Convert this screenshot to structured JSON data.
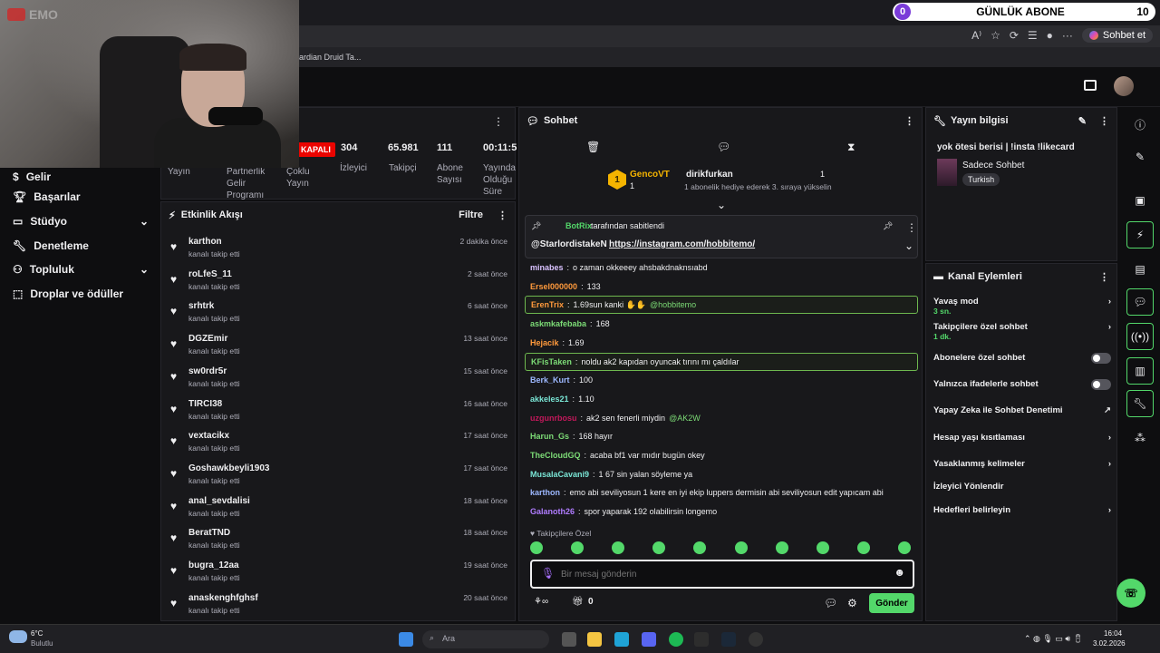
{
  "browser": {
    "sub_counter": {
      "current": "0",
      "title": "GÜNLÜK ABONE",
      "goal": "10"
    },
    "bookmark_text": "ardian Druid Ta...",
    "chat_button_label": "Sohbet et"
  },
  "webcam": {
    "logo_text": "EMO"
  },
  "left_nav": {
    "items": [
      {
        "label": "Gelir",
        "icon": "dollar-icon"
      },
      {
        "label": "Başarılar",
        "icon": "trophy-icon"
      },
      {
        "label": "Stüdyo",
        "icon": "studio-icon"
      },
      {
        "label": "Denetleme",
        "icon": "wrench-icon"
      },
      {
        "label": "Topluluk",
        "icon": "community-icon"
      },
      {
        "label": "Droplar ve ödüller",
        "icon": "drops-icon"
      }
    ]
  },
  "stats": {
    "offline_badge": "KAPALI",
    "items": [
      {
        "value": "304",
        "label": "İzleyici"
      },
      {
        "value": "65.981",
        "label": "Takipçi"
      },
      {
        "value": "111",
        "label": "Abone Sayısı"
      },
      {
        "value": "00:11:5",
        "label": "Yayında Olduğu Süre"
      }
    ],
    "left_labels": [
      "Yayın",
      "Partnerlik Gelir Programı",
      "Çoklu Yayın"
    ]
  },
  "feed": {
    "title": "Etkinlik Akışı",
    "filter_label": "Filtre",
    "rows": [
      {
        "user": "karthon",
        "action": "kanalı takip etti",
        "time": "2 dakika önce"
      },
      {
        "user": "roLfeS_11",
        "action": "kanalı takip etti",
        "time": "2 saat önce"
      },
      {
        "user": "srhtrk",
        "action": "kanalı takip etti",
        "time": "6 saat önce"
      },
      {
        "user": "DGZEmir",
        "action": "kanalı takip etti",
        "time": "13 saat önce"
      },
      {
        "user": "sw0rdr5r",
        "action": "kanalı takip etti",
        "time": "15 saat önce"
      },
      {
        "user": "TIRCI38",
        "action": "kanalı takip etti",
        "time": "16 saat önce"
      },
      {
        "user": "vextacikx",
        "action": "kanalı takip etti",
        "time": "17 saat önce"
      },
      {
        "user": "Goshawkbeyli1903",
        "action": "kanalı takip etti",
        "time": "17 saat önce"
      },
      {
        "user": "anal_sevdalisi",
        "action": "kanalı takip etti",
        "time": "18 saat önce"
      },
      {
        "user": "BeratTND",
        "action": "kanalı takip etti",
        "time": "18 saat önce"
      },
      {
        "user": "bugra_12aa",
        "action": "kanalı takip etti",
        "time": "19 saat önce"
      },
      {
        "user": "anaskenghfghsf",
        "action": "kanalı takip etti",
        "time": "20 saat önce"
      }
    ]
  },
  "chat": {
    "title": "Sohbet",
    "gift": {
      "rank": "1",
      "gifter": "GencoVT",
      "gifter_count": "1",
      "recipient": "dirikfurkan",
      "recipient_count": "1",
      "message": "1 abonelik hediye ederek 3. sıraya yükselin"
    },
    "pinned": {
      "by_user": "BotRix",
      "by_text": "tarafından sabitlendi",
      "mention": "@StarlordistakeN",
      "link": "https://instagram.com/hobbitemo/"
    },
    "messages": [
      {
        "user": "minabes",
        "color": "#d9c2ff",
        "text": "o zaman okkeeey ahsbakdnaknsıabd",
        "highlight": false
      },
      {
        "user": "Ersel000000",
        "color": "#ff9a3c",
        "text": "133",
        "highlight": false
      },
      {
        "user": "ErenTrix",
        "color": "#ff9a3c",
        "text": "1.69sun kanki ✋✋",
        "mention": "@hobbitemo",
        "highlight": true
      },
      {
        "user": "askmkafebaba",
        "color": "#7cdb76",
        "text": "168",
        "highlight": false
      },
      {
        "user": "Hejacik",
        "color": "#ff9a3c",
        "text": "1.69",
        "highlight": false
      },
      {
        "user": "KFisTaken",
        "color": "#7cdb76",
        "text": "noldu ak2 kapıdan oyuncak tırını mı çaldılar",
        "highlight": true
      },
      {
        "user": "Berk_Kurt",
        "color": "#9db8ff",
        "text": "100",
        "highlight": false
      },
      {
        "user": "akkeles21",
        "color": "#7ae6d6",
        "text": "1.10",
        "highlight": false
      },
      {
        "user": "uzgunrbosu",
        "color": "#c2185b",
        "text": "ak2 sen fenerli miydin",
        "mention": "@AK2W",
        "highlight": false
      },
      {
        "user": "Harun_Gs",
        "color": "#7cdb76",
        "text": "168 hayır",
        "highlight": false
      },
      {
        "user": "TheCloudGQ",
        "color": "#7cdb76",
        "text": "acaba bf1 var mıdır bugün okey",
        "highlight": false
      },
      {
        "user": "MusalaCavani9",
        "color": "#7ae6d6",
        "text": "1 67 sin yalan söyleme ya",
        "highlight": false
      },
      {
        "user": "karthon",
        "color": "#9db8ff",
        "text": "emo abi seviliyosun 1 kere en iyi ekip luppers dermisin abi seviliyosun edit yapıcam abi",
        "highlight": false
      },
      {
        "user": "Galanoth26",
        "color": "#b07cff",
        "text": "spor yaparak 192 olabilirsin longemo",
        "highlight": false
      }
    ],
    "followers_only_label": "Takipçilere Özel",
    "input_placeholder": "Bir mesaj gönderin",
    "points_count": "0",
    "send_label": "Gönder"
  },
  "stream_info": {
    "title": "Yayın bilgisi",
    "stream_title": "yok ötesi berisi | !insta !likecard",
    "category": "Sadece Sohbet",
    "language_tag": "Turkish"
  },
  "channel_actions": {
    "title": "Kanal Eylemleri",
    "rows": [
      {
        "label": "Yavaş mod",
        "sub": "3 sn.",
        "control": "chevron"
      },
      {
        "label": "Takipçilere özel sohbet",
        "sub": "1 dk.",
        "control": "chevron"
      },
      {
        "label": "Abonelere özel sohbet",
        "sub": "",
        "control": "toggle"
      },
      {
        "label": "Yalnızca ifadelerle sohbet",
        "sub": "",
        "control": "toggle"
      },
      {
        "label": "Yapay Zeka ile Sohbet Denetimi",
        "sub": "",
        "control": "external"
      },
      {
        "label": "Hesap yaşı kısıtlaması",
        "sub": "",
        "control": "chevron"
      },
      {
        "label": "Yasaklanmış kelimeler",
        "sub": "",
        "control": "chevron"
      },
      {
        "label": "İzleyici Yönlendir",
        "sub": "",
        "control": "none"
      },
      {
        "label": "Hedefleri belirleyin",
        "sub": "",
        "control": "chevron"
      }
    ]
  },
  "taskbar": {
    "weather_temp": "6°C",
    "weather_text": "Bulutlu",
    "search_placeholder": "Ara",
    "time": "16:04",
    "date": "3.02.2026"
  },
  "colors": {
    "accent": "#53d86a",
    "offline": "#eb0400",
    "panel": "#18181b",
    "bg": "#0e0e10"
  }
}
